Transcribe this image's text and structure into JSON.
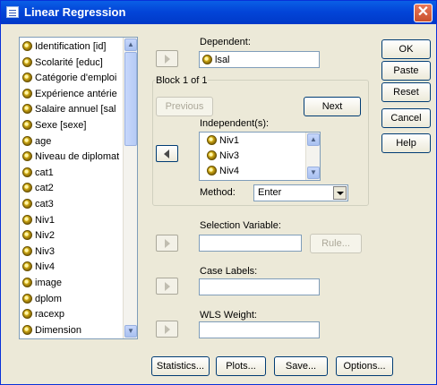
{
  "window": {
    "title": "Linear Regression",
    "close_glyph": "✕"
  },
  "variables": [
    "Identification [id]",
    "Scolarité [educ]",
    "Catégorie d'emploi",
    "Expérience antérie",
    "Salaire annuel [sal",
    "Sexe [sexe]",
    "age",
    "Niveau de diplomat",
    "cat1",
    "cat2",
    "cat3",
    "Niv1",
    "Niv2",
    "Niv3",
    "Niv4",
    "image",
    "dplom",
    "racexp",
    "Dimension"
  ],
  "dependent": {
    "label": "Dependent:",
    "value": "lsal"
  },
  "block": {
    "title": "Block 1 of 1",
    "previous": "Previous",
    "next": "Next"
  },
  "independents": {
    "label": "Independent(s):",
    "items": [
      "Niv1",
      "Niv3",
      "Niv4"
    ]
  },
  "method": {
    "label": "Method:",
    "value": "Enter"
  },
  "selection": {
    "label": "Selection Variable:",
    "rule_button": "Rule..."
  },
  "case_labels": {
    "label": "Case Labels:"
  },
  "wls": {
    "label": "WLS Weight:"
  },
  "side_buttons": [
    "OK",
    "Paste",
    "Reset",
    "Cancel",
    "Help"
  ],
  "bottom_buttons": [
    "Statistics...",
    "Plots...",
    "Save...",
    "Options..."
  ]
}
